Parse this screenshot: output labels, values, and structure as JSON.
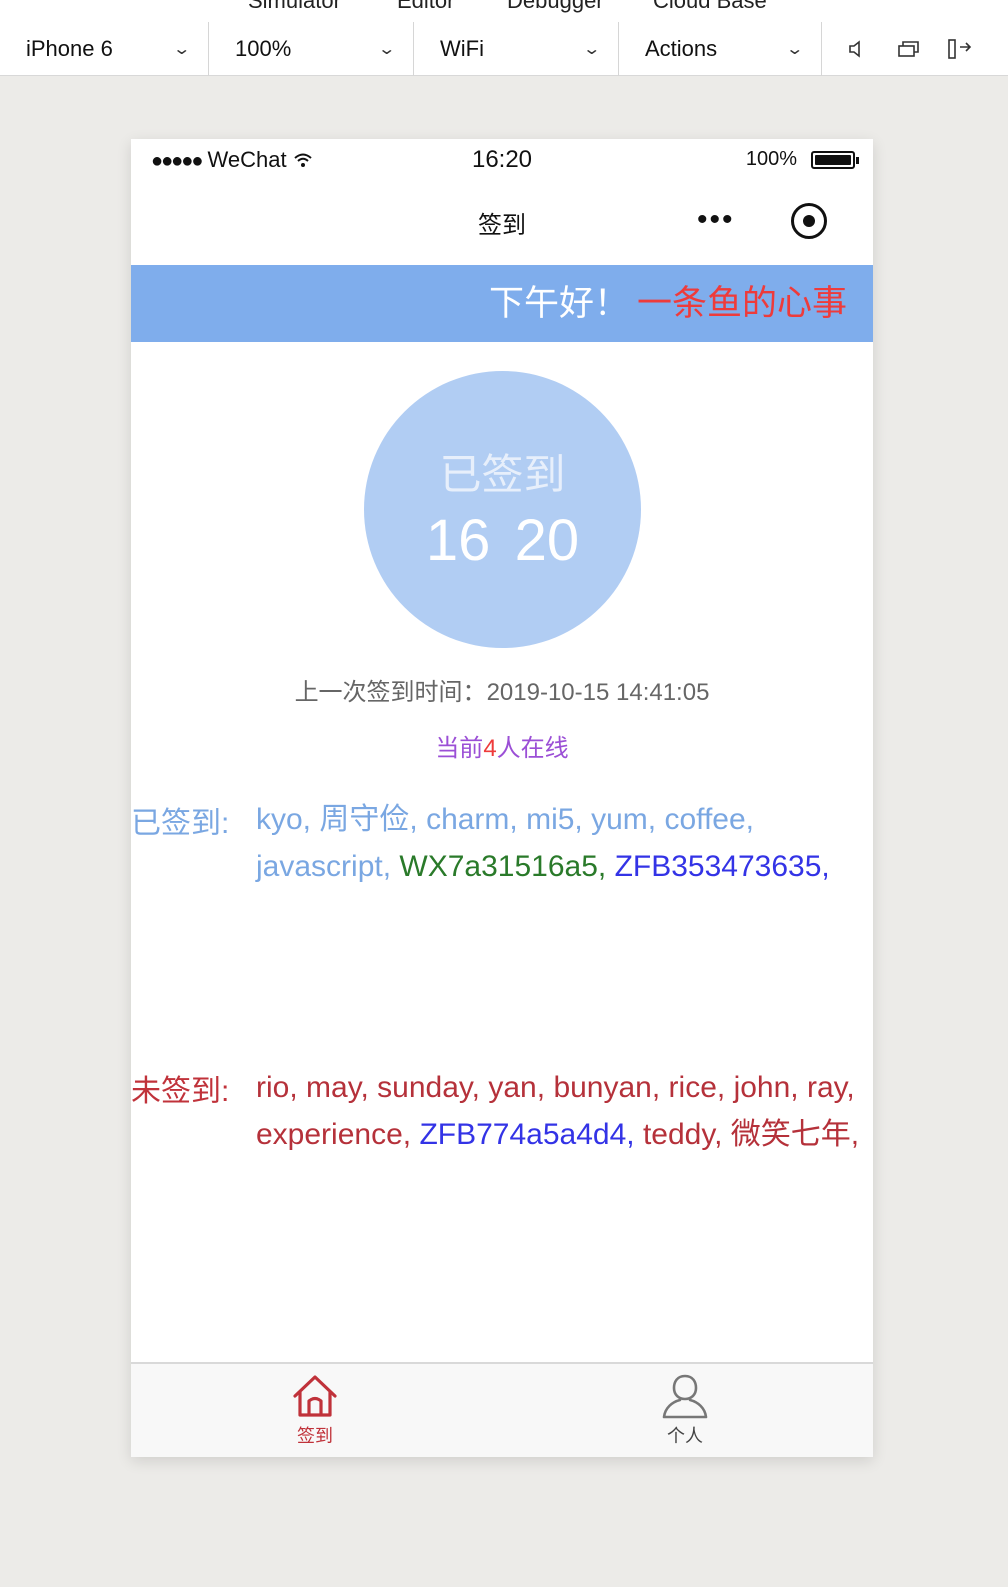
{
  "devtools": {
    "tabs": [
      "Simulator",
      "Editor",
      "Debugger",
      "Cloud Base"
    ],
    "device": "iPhone 6",
    "zoom": "100%",
    "network": "WiFi",
    "actions": "Actions",
    "icons": [
      "speaker-icon",
      "window-icon",
      "detach-icon"
    ]
  },
  "statusbar": {
    "dots": "●●●●●",
    "carrier": "WeChat",
    "time": "16:20",
    "battery": "100%"
  },
  "navbar": {
    "title": "签到",
    "more": "•••"
  },
  "banner": {
    "greeting": "下午好！",
    "username": "一条鱼的心事"
  },
  "checkin": {
    "status": "已签到",
    "hour": "16",
    "minute": "20",
    "last_time_label": "上一次签到时间：",
    "last_time": "2019-10-15 14:41:05",
    "online_prefix": "当前",
    "online_count": "4",
    "online_suffix": "人在线"
  },
  "signed": {
    "label": "已签到:",
    "names": [
      {
        "text": "kyo,",
        "color": "#7aa7e2"
      },
      {
        "text": "周守俭,",
        "color": "#7aa7e2"
      },
      {
        "text": "charm,",
        "color": "#7aa7e2"
      },
      {
        "text": "mi5,",
        "color": "#7aa7e2"
      },
      {
        "text": "yum,",
        "color": "#7aa7e2"
      },
      {
        "text": "coffee,",
        "color": "#7aa7e2"
      },
      {
        "text": "javascript,",
        "color": "#7aa7e2"
      },
      {
        "text": "WX7a31516a5,",
        "color": "#2a7a2a"
      },
      {
        "text": "ZFB353473635,",
        "color": "#3333e6"
      }
    ]
  },
  "unsigned": {
    "label": "未签到:",
    "names": [
      {
        "text": "rio,",
        "color": "#b5313a"
      },
      {
        "text": "may,",
        "color": "#b5313a"
      },
      {
        "text": "sunday,",
        "color": "#b5313a"
      },
      {
        "text": "yan,",
        "color": "#b5313a"
      },
      {
        "text": "bunyan,",
        "color": "#b5313a"
      },
      {
        "text": "rice,",
        "color": "#b5313a"
      },
      {
        "text": "john,",
        "color": "#b5313a"
      },
      {
        "text": "ray,",
        "color": "#b5313a"
      },
      {
        "text": "experience,",
        "color": "#b5313a"
      },
      {
        "text": "ZFB774a5a4d4,",
        "color": "#3333e6"
      },
      {
        "text": "teddy,",
        "color": "#b5313a"
      },
      {
        "text": "微笑七年,",
        "color": "#b5313a"
      }
    ]
  },
  "tabbar": {
    "tabs": [
      {
        "label": "签到",
        "icon": "home-icon",
        "active": true
      },
      {
        "label": "个人",
        "icon": "person-icon",
        "active": false
      }
    ]
  },
  "colors": {
    "banner": "#7fadec",
    "circle": "#b1cdf3",
    "accent_red": "#c0323a",
    "online_purple": "#9b4fd6"
  }
}
